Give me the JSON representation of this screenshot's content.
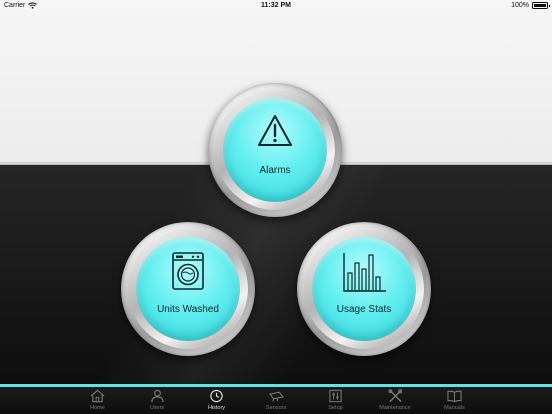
{
  "status_bar": {
    "carrier": "Carrier",
    "time": "11:32 PM",
    "battery": "100%"
  },
  "dials": {
    "alarms": {
      "label": "Alarms",
      "icon": "warning-icon"
    },
    "units_washed": {
      "label": "Units Washed",
      "icon": "washing-machine-icon"
    },
    "usage_stats": {
      "label": "Usage Stats",
      "icon": "bar-chart-icon"
    }
  },
  "tabs": [
    {
      "label": "Home",
      "icon": "home-icon",
      "active": false
    },
    {
      "label": "Users",
      "icon": "user-icon",
      "active": false
    },
    {
      "label": "History",
      "icon": "clock-icon",
      "active": true
    },
    {
      "label": "Sensors",
      "icon": "sensor-icon",
      "active": false
    },
    {
      "label": "Setup",
      "icon": "sliders-icon",
      "active": false
    },
    {
      "label": "Maintenance",
      "icon": "tools-icon",
      "active": false
    },
    {
      "label": "Manuals",
      "icon": "book-icon",
      "active": false
    }
  ],
  "colors": {
    "accent": "#5ee6e6",
    "dial_face": "#64eef0",
    "active_tab_text": "#e0e0e0",
    "inactive_tab_text": "#7a7a7a"
  }
}
